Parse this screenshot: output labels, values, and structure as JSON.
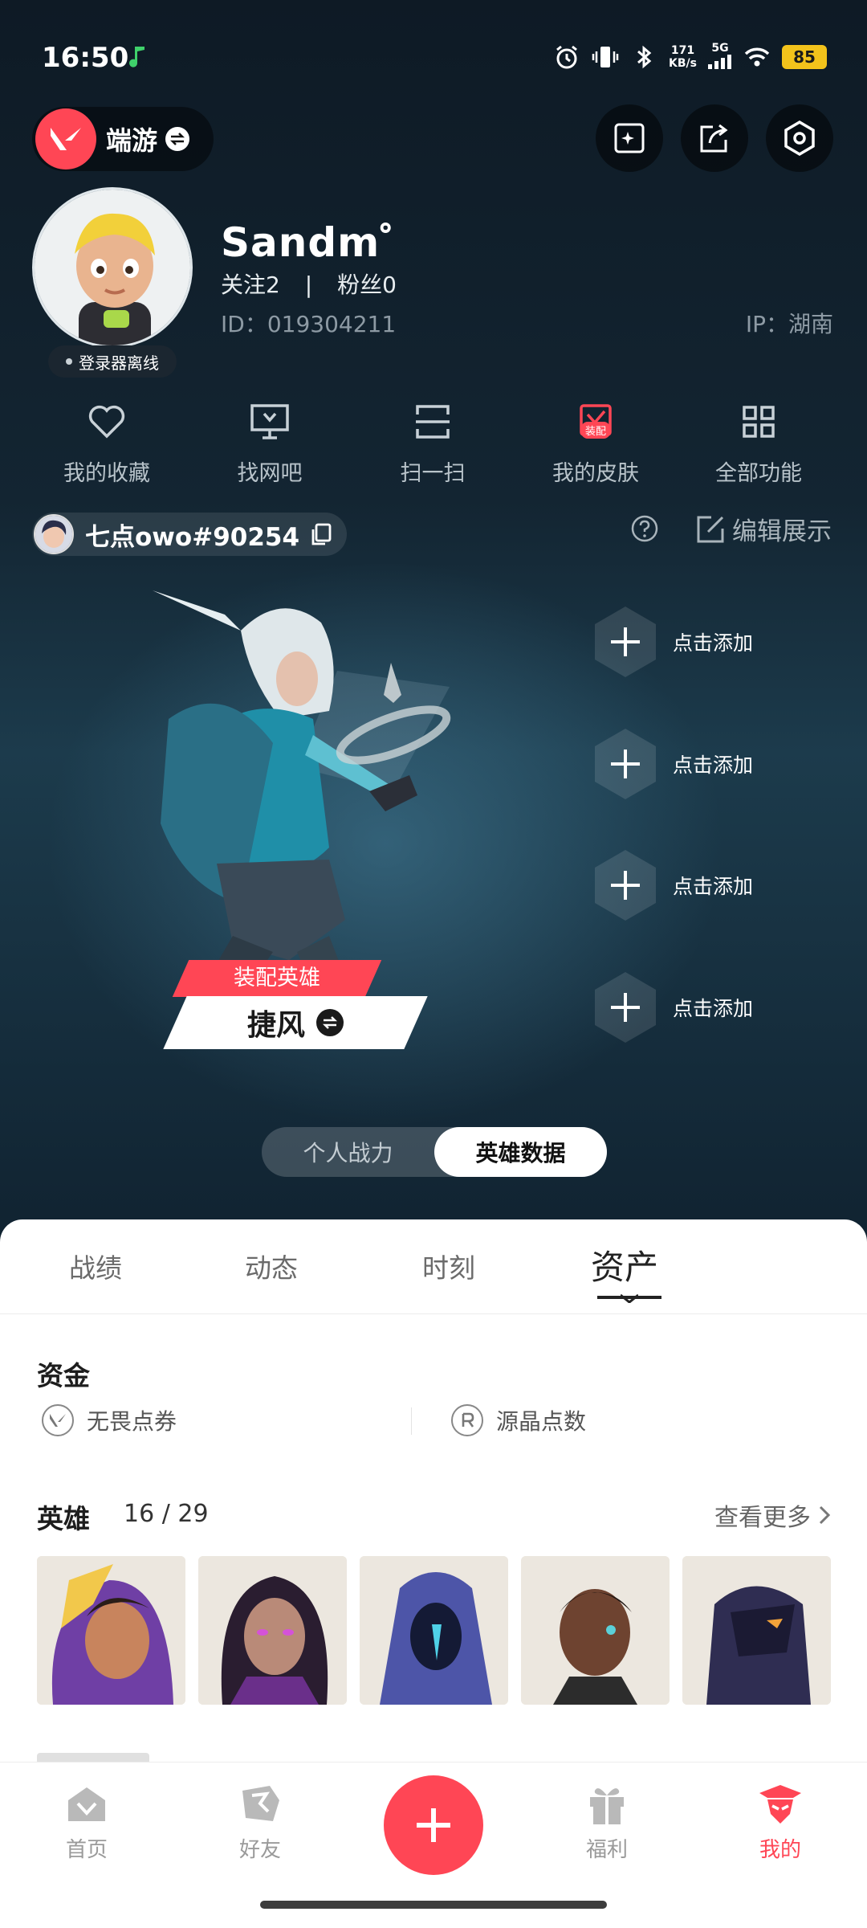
{
  "status_bar": {
    "time": "16:50",
    "net_speed_value": "171",
    "net_speed_unit": "KB/s",
    "network": "5G",
    "battery": "85"
  },
  "top_bar": {
    "brand_label": "端游"
  },
  "profile": {
    "username": "Sandm゜",
    "follow_label": "关注",
    "follow_count": "2",
    "fans_label": "粉丝",
    "fans_count": "0",
    "id_text": "ID：019304211",
    "ip_text": "IP：湖南",
    "status": "登录器离线"
  },
  "quick_functions": [
    {
      "label": "我的收藏",
      "icon": "heart-icon"
    },
    {
      "label": "找网吧",
      "icon": "monitor-icon"
    },
    {
      "label": "扫一扫",
      "icon": "scan-icon"
    },
    {
      "label": "我的皮肤",
      "icon": "skin-icon",
      "badge": "装配"
    },
    {
      "label": "全部功能",
      "icon": "grid-icon"
    }
  ],
  "riot_id": "七点owo#90254",
  "edit_show": "编辑展示",
  "hero_showcase": {
    "tag": "装配英雄",
    "hero_name": "捷风",
    "slots": [
      {
        "label": "点击添加"
      },
      {
        "label": "点击添加"
      },
      {
        "label": "点击添加"
      },
      {
        "label": "点击添加"
      }
    ]
  },
  "toggle": {
    "options": [
      "个人战力",
      "英雄数据"
    ],
    "active": "英雄数据"
  },
  "tabs": [
    "战绩",
    "动态",
    "时刻",
    "资产"
  ],
  "active_tab": "资产",
  "funds": {
    "title": "资金",
    "items": [
      "无畏点券",
      "源晶点数"
    ]
  },
  "heroes": {
    "title": "英雄",
    "owned": "16",
    "total": "29",
    "see_more": "查看更多"
  },
  "bottom_nav": [
    {
      "label": "首页",
      "icon": "home-icon"
    },
    {
      "label": "好友",
      "icon": "friends-icon"
    },
    {
      "label": "福利",
      "icon": "gift-icon"
    },
    {
      "label": "我的",
      "icon": "profile-icon"
    }
  ],
  "colors": {
    "accent": "#ff4655",
    "dark_bg": "#0f1d28",
    "battery": "#f3c31b"
  }
}
